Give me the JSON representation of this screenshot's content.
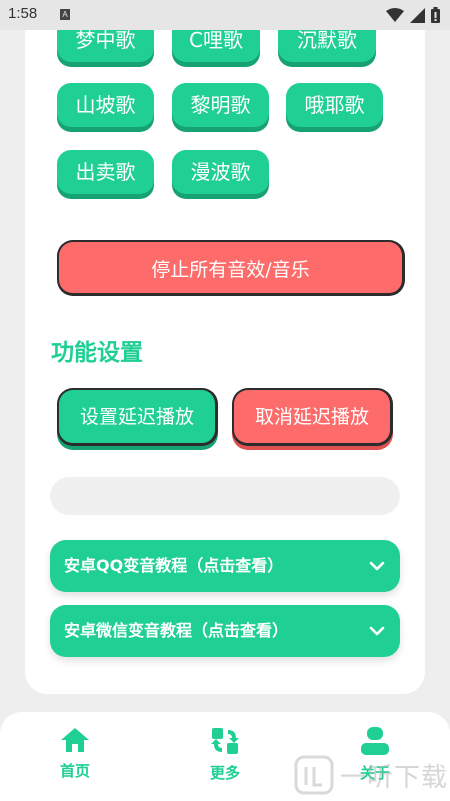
{
  "status_bar": {
    "time": "1:58",
    "app_icon": "A"
  },
  "songs": {
    "row_top_partial": [
      "",
      "",
      ""
    ],
    "row1": [
      "梦中歌",
      "C哩歌",
      "沉默歌"
    ],
    "row2": [
      "山坡歌",
      "黎明歌",
      "哦耶歌"
    ],
    "row3": [
      "出卖歌",
      "漫波歌"
    ]
  },
  "stop_all_label": "停止所有音效/音乐",
  "function_section": {
    "title": "功能设置",
    "set_delay_label": "设置延迟播放",
    "cancel_delay_label": "取消延迟播放",
    "delay_input_value": ""
  },
  "tutorials": [
    {
      "label": "安卓QQ变音教程（点击查看）"
    },
    {
      "label": "安卓微信变音教程（点击查看）"
    }
  ],
  "bottom_nav": {
    "items": [
      {
        "label": "首页",
        "icon": "home-icon"
      },
      {
        "label": "更多",
        "icon": "refresh-apps-icon"
      },
      {
        "label": "关于",
        "icon": "user-icon"
      }
    ]
  },
  "watermark": {
    "text": "一听下载"
  },
  "colors": {
    "accent_green": "#1fcf93",
    "accent_red": "#fd6c6b",
    "background": "#eeeeee"
  }
}
